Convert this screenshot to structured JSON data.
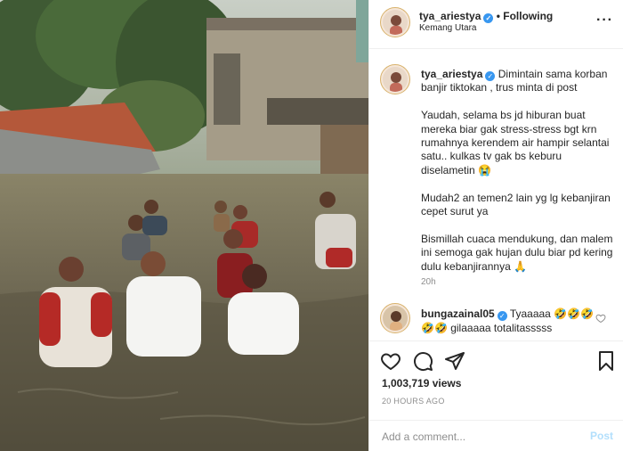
{
  "post": {
    "username": "tya_ariestya",
    "verified_icon": "verified-badge-icon",
    "following_label": "• Following",
    "location": "Kemang Utara",
    "caption": "Dimintain sama korban banjir tiktokan , trus minta di post\n\nYaudah, selama bs jd hiburan buat mereka biar gak stress-stress bgt krn rumahnya kerendem air hampir selantai satu.. kulkas tv gak bs keburu diselametin 😭\n\nMudah2 an temen2 lain yg lg kebanjiran cepet surut ya\n\nBismillah cuaca mendukung, dan malem ini semoga gak hujan dulu biar pd kering dulu kebanjirannya 🙏",
    "caption_time": "20h"
  },
  "comments": [
    {
      "username": "bungazainal05",
      "text": "Tyaaaaa 🤣🤣🤣🤣🤣 gilaaaaa totalitasssss"
    }
  ],
  "stats": {
    "views": "1,003,719 views",
    "posted_ago": "20 HOURS AGO"
  },
  "composer": {
    "placeholder": "Add a comment...",
    "post_label": "Post"
  },
  "colors": {
    "accent_blue": "#3897f0",
    "post_disabled": "#b2dffc",
    "muted": "#8e8e8e"
  },
  "icons": [
    "more-options-icon",
    "heart-icon",
    "comment-icon",
    "share-icon",
    "bookmark-icon",
    "comment-like-icon"
  ]
}
